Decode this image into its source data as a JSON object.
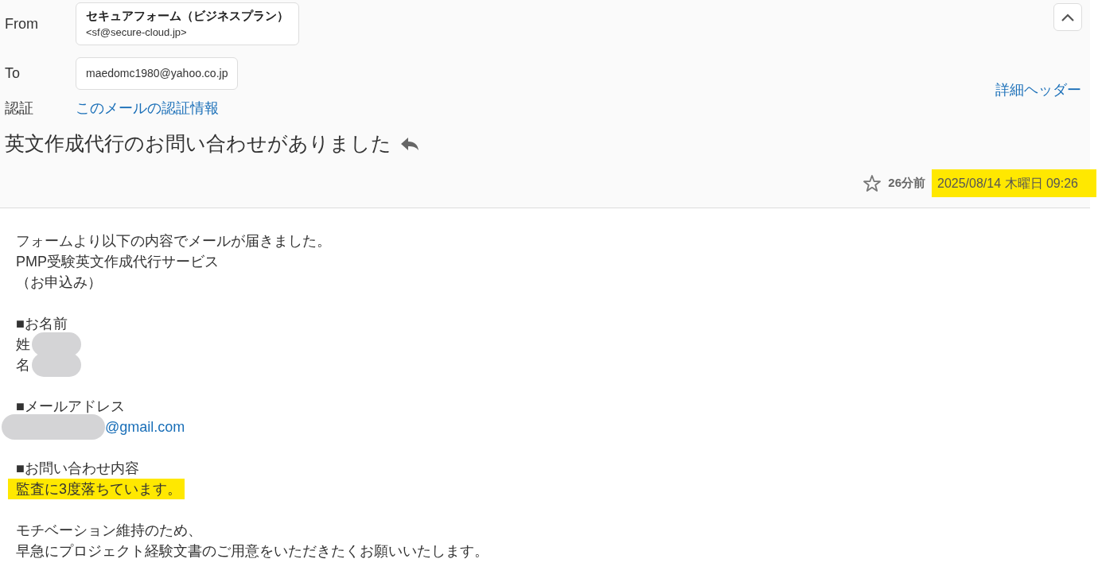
{
  "header": {
    "from_label": "From",
    "from_name": "セキュアフォーム（ビジネスプラン）",
    "from_address": "<sf@secure-cloud.jp>",
    "to_label": "To",
    "to_address": "maedomc1980@yahoo.co.jp",
    "auth_label": "認証",
    "auth_link": "このメールの認証情報",
    "details_link": "詳細ヘッダー",
    "collapsed": false
  },
  "subject": "英文作成代行のお問い合わせがありました",
  "meta": {
    "starred": false,
    "relative_time": "26分前",
    "date": "2025/08/14 木曜日 09:26",
    "highlighted": true
  },
  "body": [
    {
      "kind": "text",
      "text": "フォームより以下の内容でメールが届きました。",
      "highlighted": false
    },
    {
      "kind": "text",
      "text": "PMP受験英文作成代行サービス",
      "highlighted": false
    },
    {
      "kind": "text",
      "text": "（お申込み）",
      "highlighted": false
    },
    {
      "kind": "blank"
    },
    {
      "kind": "text",
      "text": "■お名前",
      "highlighted": false
    },
    {
      "kind": "redacted",
      "text": "姓"
    },
    {
      "kind": "redacted",
      "text": "名"
    },
    {
      "kind": "blank"
    },
    {
      "kind": "text",
      "text": "■メールアドレス",
      "highlighted": false
    },
    {
      "kind": "redacted-link",
      "text": "@gmail.com"
    },
    {
      "kind": "blank"
    },
    {
      "kind": "text",
      "text": "■お問い合わせ内容",
      "highlighted": false
    },
    {
      "kind": "text",
      "text": "監査に3度落ちています。",
      "highlighted": true
    },
    {
      "kind": "blank"
    },
    {
      "kind": "text",
      "text": "モチベーション維持のため、",
      "highlighted": false
    },
    {
      "kind": "text",
      "text": "早急にプロジェクト経験文書のご用意をいただきたくお願いいたします。",
      "highlighted": false
    }
  ]
}
